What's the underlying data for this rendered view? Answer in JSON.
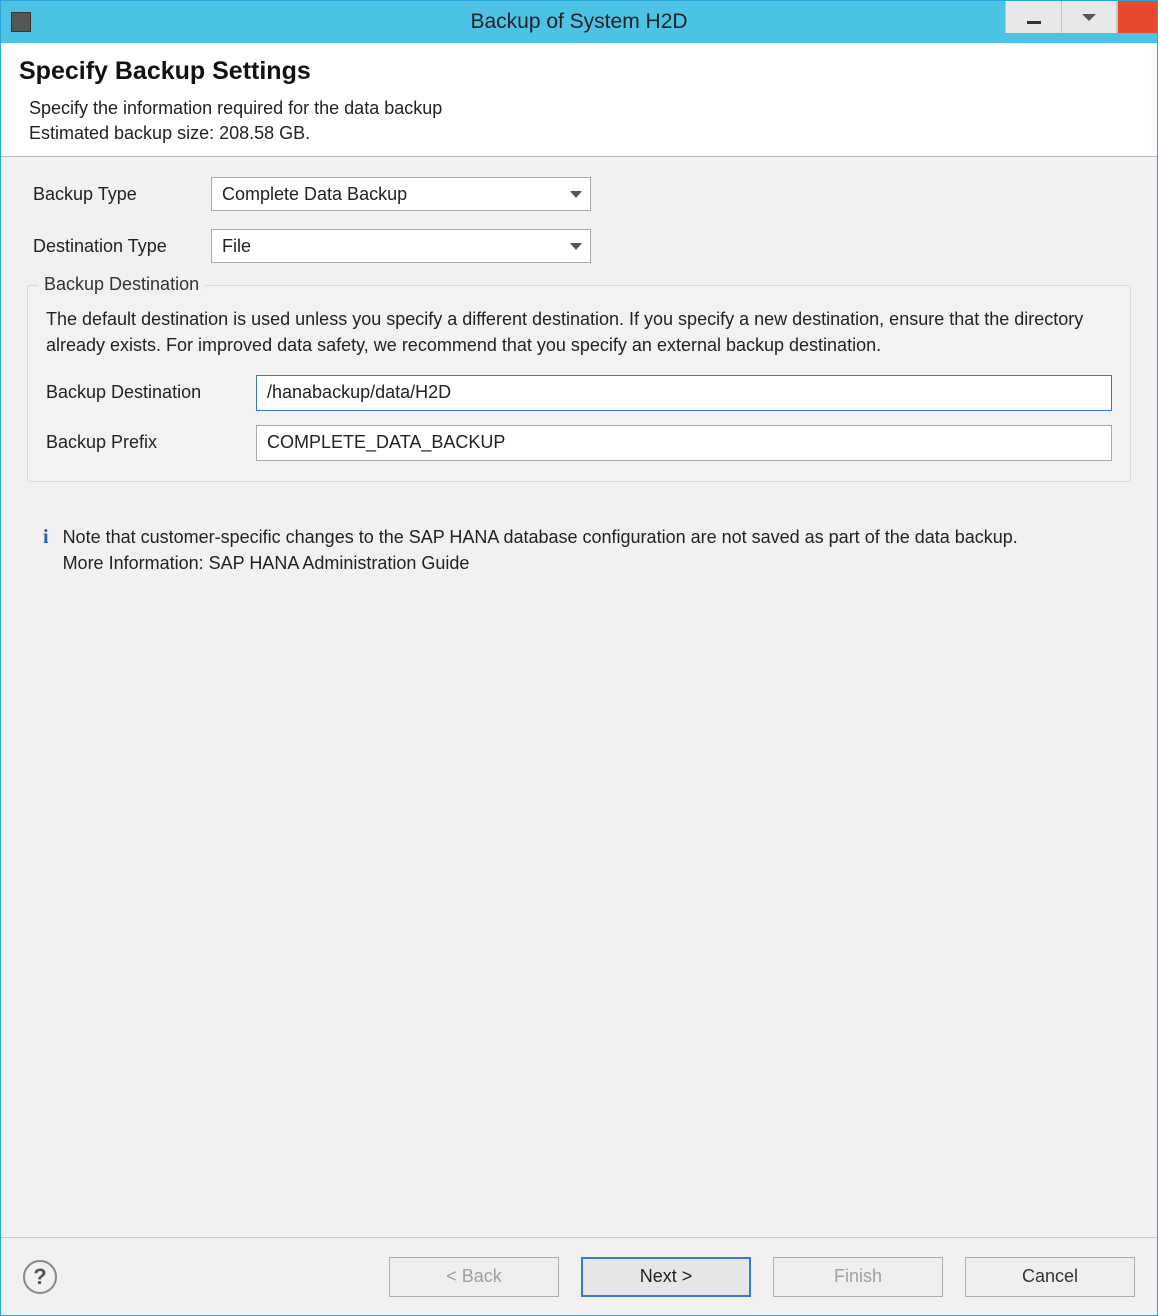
{
  "window": {
    "title": "Backup of System H2D"
  },
  "header": {
    "title": "Specify Backup Settings",
    "line1": "Specify the information required for the data backup",
    "line2": "Estimated backup size: 208.58 GB."
  },
  "form": {
    "backup_type_label": "Backup Type",
    "backup_type_value": "Complete Data Backup",
    "destination_type_label": "Destination Type",
    "destination_type_value": "File"
  },
  "fieldset": {
    "legend": "Backup Destination",
    "description": "The default destination is used unless you specify a different destination. If you specify a new destination, ensure that the directory already exists. For improved data safety, we recommend that you specify an external backup destination.",
    "dest_label": "Backup Destination",
    "dest_value": "/hanabackup/data/H2D",
    "prefix_label": "Backup Prefix",
    "prefix_value": "COMPLETE_DATA_BACKUP"
  },
  "info": {
    "line1": "Note that customer-specific changes to the SAP HANA database configuration are not saved as part of the data backup.",
    "line2": "More Information: SAP HANA Administration Guide"
  },
  "buttons": {
    "back": "< Back",
    "next": "Next >",
    "finish": "Finish",
    "cancel": "Cancel"
  }
}
